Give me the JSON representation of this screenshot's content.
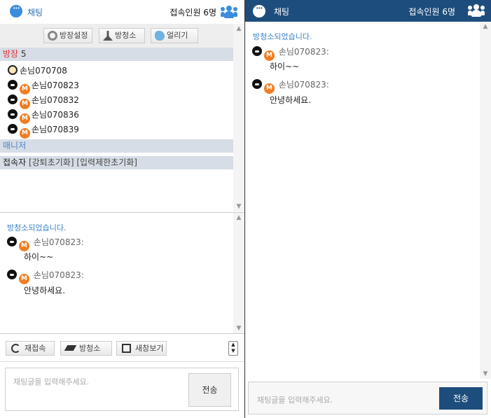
{
  "left": {
    "header": {
      "title": "채팅",
      "count": "접속인원 6명"
    },
    "toolbar": {
      "room_settings": "방장설정",
      "clear": "방청소",
      "freeze": "얼리기"
    },
    "owner_section": {
      "label": "방장",
      "count": "5"
    },
    "participants": [
      "손님070708",
      "손님070823",
      "손님070832",
      "손님070836",
      "손님070839"
    ],
    "manager_section": {
      "label": "매니저"
    },
    "viewer_section": {
      "label": "접속자",
      "resets": "[강퇴초기화] [입력제한초기화]"
    },
    "chat": {
      "system": "방청소되었습니다.",
      "messages": [
        {
          "user": "손님070823:",
          "text": "하이~~"
        },
        {
          "user": "손님070823:",
          "text": "안녕하세요."
        }
      ]
    },
    "buttons": {
      "reconnect": "재접속",
      "clear": "방청소",
      "new_window": "새창보기"
    },
    "input": {
      "placeholder": "채팅글을 입력해주세요.",
      "send": "전송"
    }
  },
  "right": {
    "header": {
      "title": "채팅",
      "count": "접속인원 6명"
    },
    "chat": {
      "system": "방청소되었습니다.",
      "messages": [
        {
          "user": "손님070823:",
          "text": "하이~~"
        },
        {
          "user": "손님070823:",
          "text": "안녕하세요."
        }
      ]
    },
    "input": {
      "placeholder": "채팅글을 입력해주세요.",
      "send": "전송"
    }
  },
  "colors": {
    "brand_blue": "#1d4d7c",
    "accent_blue": "#3a8dde",
    "owner_red": "#dd3333",
    "m_badge_orange": "#f07d21"
  },
  "icons": [
    "chat-bubble-icon",
    "people-icon",
    "gear-icon",
    "broom-icon",
    "ice-icon",
    "reload-icon",
    "eraser-icon",
    "new-window-icon",
    "ninja-face-icon",
    "smile-face-icon",
    "m-badge-icon"
  ]
}
